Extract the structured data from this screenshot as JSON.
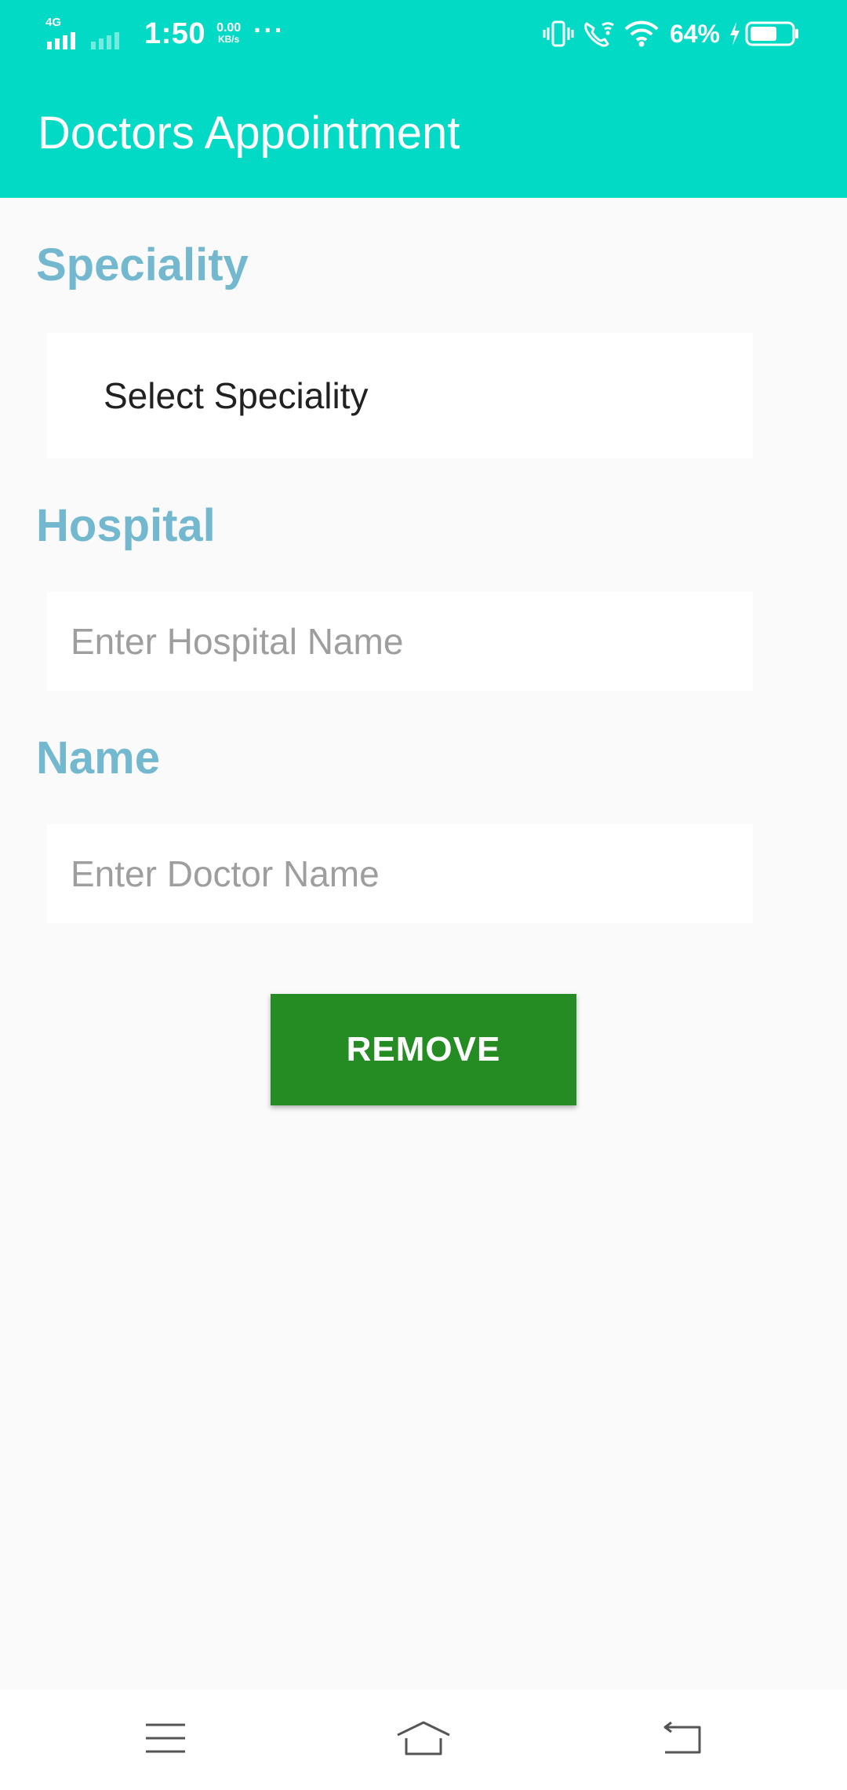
{
  "status_bar": {
    "network": "4G",
    "time": "1:50",
    "speed_value": "0.00",
    "speed_unit": "KB/s",
    "more": "···",
    "battery_percent": "64%",
    "icons": [
      "vibrate-icon",
      "wifi-calling-icon",
      "wifi-icon",
      "charging-icon",
      "battery-icon"
    ]
  },
  "app_bar": {
    "title": "Doctors Appointment"
  },
  "form": {
    "speciality_label": "Speciality",
    "speciality_selected": "Select Speciality",
    "hospital_label": "Hospital",
    "hospital_placeholder": "Enter Hospital Name",
    "hospital_value": "",
    "name_label": "Name",
    "name_placeholder": "Enter Doctor Name",
    "name_value": "",
    "remove_button": "REMOVE"
  },
  "nav_bar": {
    "icons": [
      "menu-icon",
      "home-icon",
      "back-icon"
    ]
  },
  "colors": {
    "primary": "#03dac5",
    "label": "#73b8cf",
    "button": "#248c23",
    "background": "#fafafa"
  }
}
